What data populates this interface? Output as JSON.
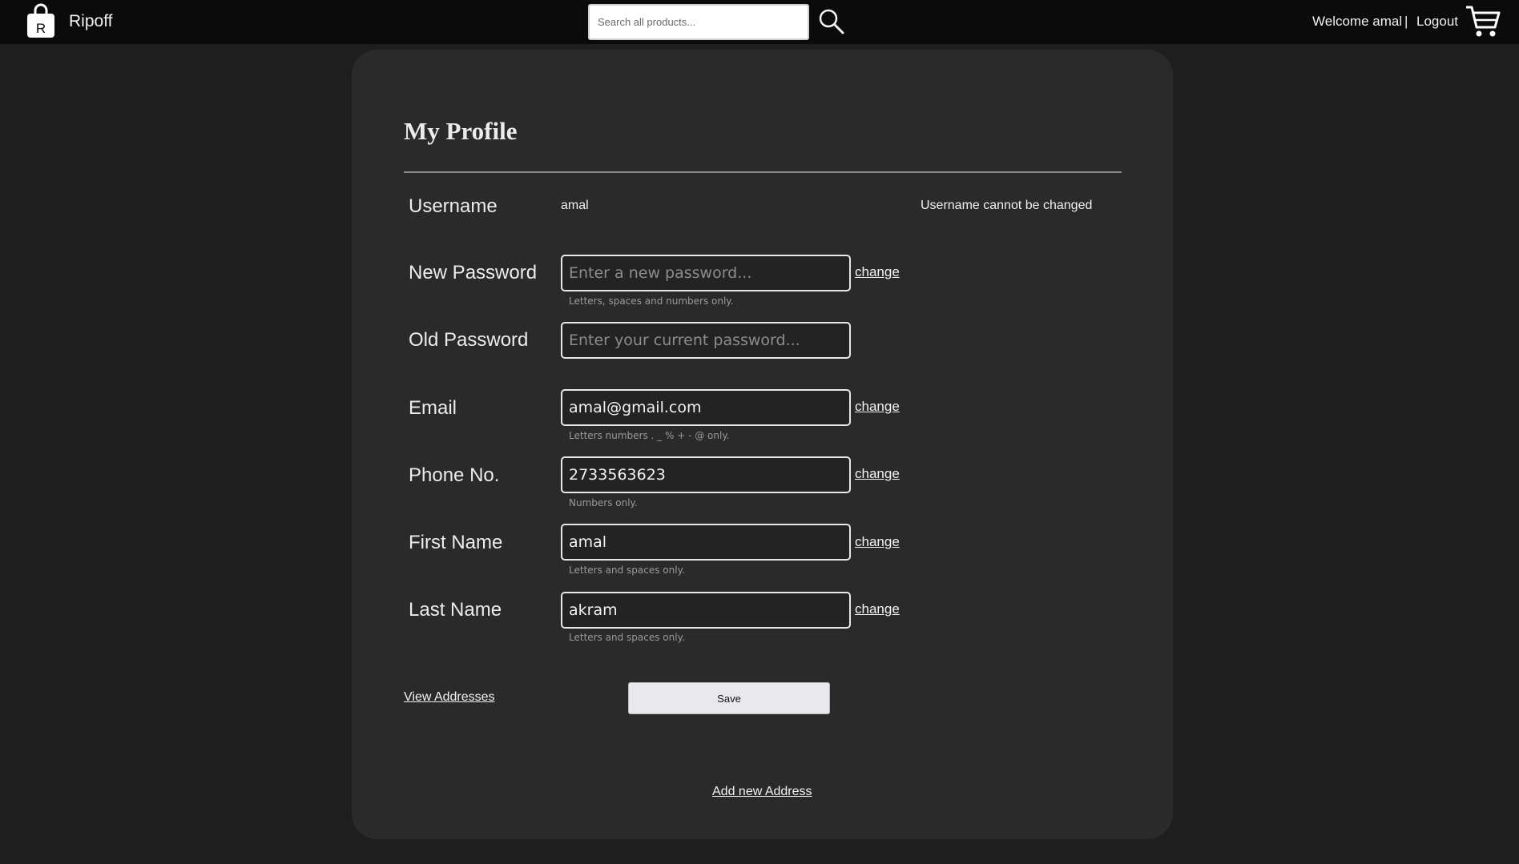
{
  "header": {
    "brand": "Ripoff",
    "logo_letter": "R",
    "search_placeholder": "Search all products...",
    "welcome": "Welcome amal",
    "separator": "|",
    "logout": "Logout"
  },
  "profile": {
    "title": "My Profile",
    "username_label": "Username",
    "username_value": "amal",
    "username_note": "Username cannot be changed",
    "new_password": {
      "label": "New Password",
      "value": "",
      "placeholder": "Enter a new password...",
      "change": "change",
      "hint": "Letters, spaces and numbers only."
    },
    "old_password": {
      "label": "Old Password",
      "value": "",
      "placeholder": "Enter your current password..."
    },
    "email": {
      "label": "Email",
      "value": "amal@gmail.com",
      "change": "change",
      "hint": "Letters numbers . _ % + - @ only."
    },
    "phone": {
      "label": "Phone No.",
      "value": "2733563623",
      "change": "change",
      "hint": "Numbers only."
    },
    "first_name": {
      "label": "First Name",
      "value": "amal",
      "change": "change",
      "hint": "Letters and spaces only."
    },
    "last_name": {
      "label": "Last Name",
      "value": "akram",
      "change": "change",
      "hint": "Letters and spaces only."
    },
    "view_addresses": "View Addresses",
    "save": "Save",
    "add_address": "Add new Address"
  },
  "icons": {
    "logo": "shopping-bag-icon",
    "search": "search-icon",
    "cart": "cart-icon"
  },
  "colors": {
    "page_bg": "#1e1e1e",
    "topbar_bg": "#0b0b0b",
    "card_bg": "#2a2a2a",
    "input_border": "#e8e8e8",
    "button_bg": "#e9e8ed"
  }
}
